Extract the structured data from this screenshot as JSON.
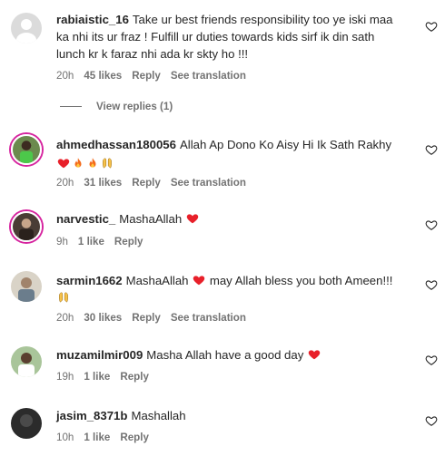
{
  "comments": [
    {
      "username": "rabiaistic_16",
      "text": "Take ur best friends responsibility too ye iski maa ka nhi its ur fraz ! Fulfill ur duties towards kids sirf ik din sath lunch kr k faraz nhi ada kr skty ho !!!",
      "time": "20h",
      "likes": "45 likes",
      "reply": "Reply",
      "translation": "See translation",
      "view_replies": "View replies (1)"
    },
    {
      "username": "ahmedhassan180056",
      "text": "Allah Ap Dono Ko Aisy Hi Ik Sath Rakhy",
      "time": "20h",
      "likes": "31 likes",
      "reply": "Reply",
      "translation": "See translation"
    },
    {
      "username": "narvestic_",
      "text": "MashaAllah",
      "time": "9h",
      "likes": "1 like",
      "reply": "Reply"
    },
    {
      "username": "sarmin1662",
      "text_before": "MashaAllah",
      "text_after": "may Allah bless you both Ameen!!!",
      "time": "20h",
      "likes": "30 likes",
      "reply": "Reply",
      "translation": "See translation"
    },
    {
      "username": "muzamilmir009",
      "text": "Masha Allah have a good day",
      "time": "19h",
      "likes": "1 like",
      "reply": "Reply"
    },
    {
      "username": "jasim_8371b",
      "text": "Mashallah",
      "time": "10h",
      "likes": "1 like",
      "reply": "Reply"
    }
  ],
  "icons": {
    "like": "heart-outline-icon",
    "red_heart": "red-heart-emoji",
    "fire": "fire-emoji",
    "hands": "open-hands-emoji"
  },
  "colors": {
    "heart_red": "#e8202a",
    "meta_gray": "#737373",
    "story_ring": "#d6249f"
  }
}
